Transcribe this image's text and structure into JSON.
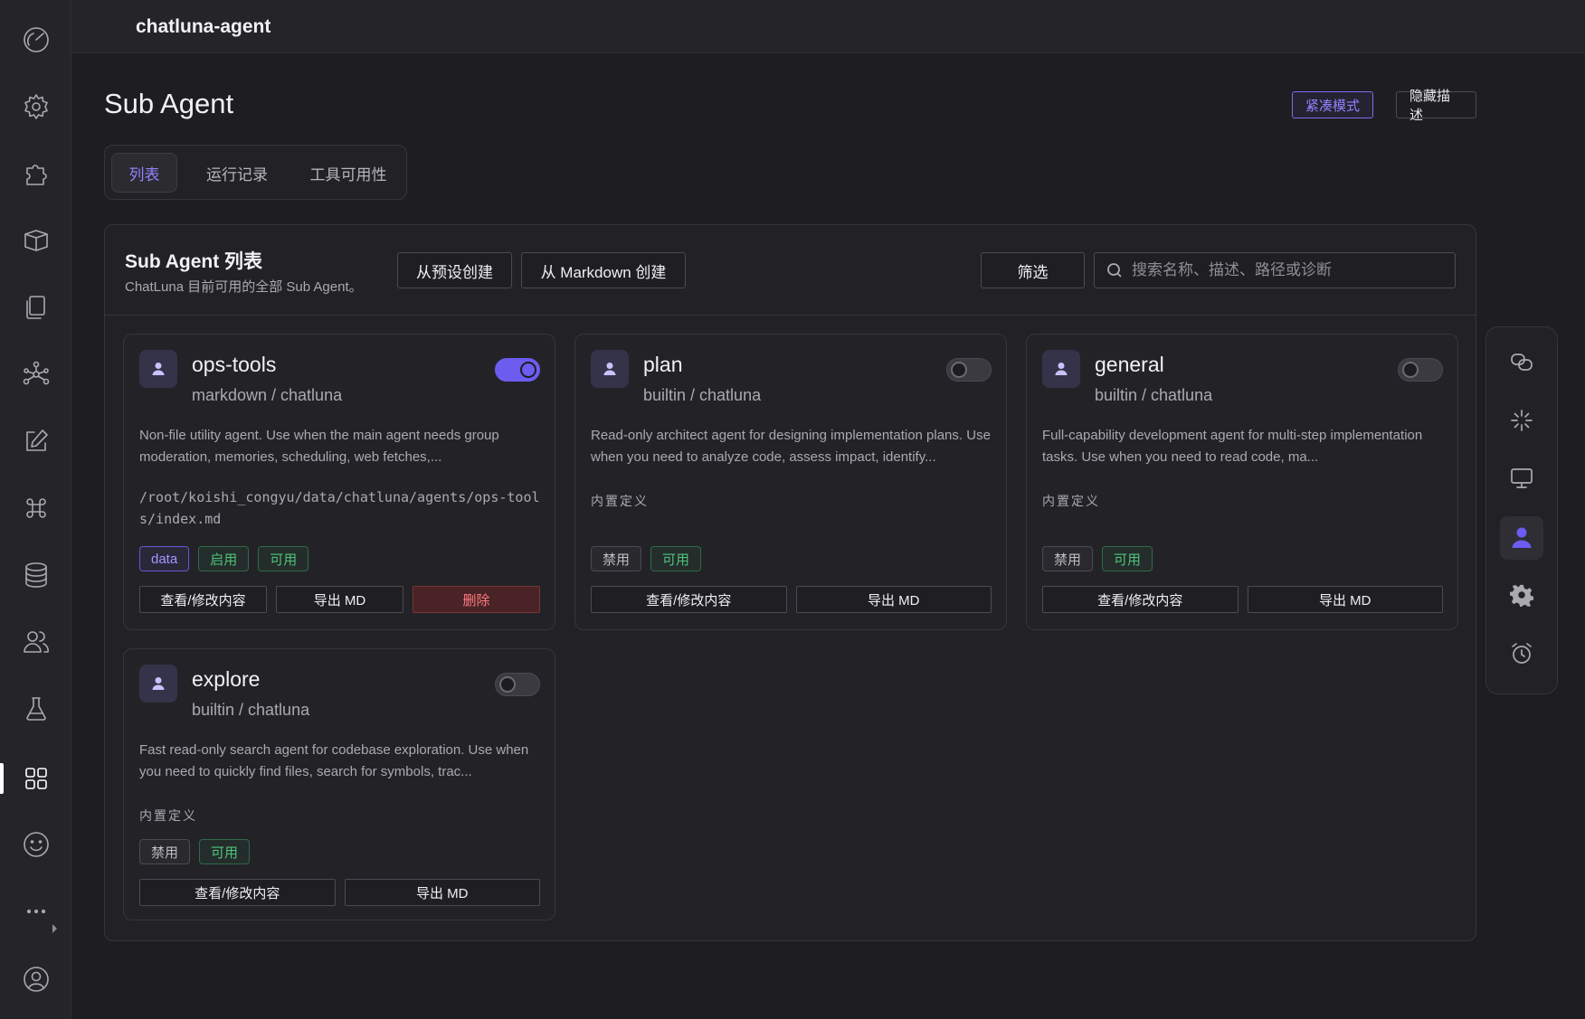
{
  "topbar": {
    "title": "chatluna-agent"
  },
  "page": {
    "title": "Sub Agent",
    "compact_mode_label": "紧凑模式",
    "hide_desc_label": "隐藏描述"
  },
  "tabs": [
    {
      "label": "列表",
      "active": true
    },
    {
      "label": "运行记录",
      "active": false
    },
    {
      "label": "工具可用性",
      "active": false
    }
  ],
  "panel": {
    "title": "Sub Agent 列表",
    "subtitle": "ChatLuna 目前可用的全部 Sub Agent。",
    "create_preset_label": "从预设创建",
    "create_markdown_label": "从 Markdown 创建",
    "filter_label": "筛选",
    "search_placeholder": "搜索名称、描述、路径或诊断"
  },
  "agents": [
    {
      "name": "ops-tools",
      "source": "markdown / chatluna",
      "enabled": true,
      "description": "Non-file utility agent. Use when the main agent needs group moderation, memories, scheduling, web fetches,...",
      "path": "/root/koishi_congyu/data/chatluna/agents/ops-tools/index.md",
      "tags": [
        "data",
        "启用",
        "可用"
      ],
      "actions": [
        "查看/修改内容",
        "导出 MD",
        "删除"
      ]
    },
    {
      "name": "plan",
      "source": "builtin / chatluna",
      "enabled": false,
      "description": "Read-only architect agent for designing implementation plans. Use when you need to analyze code, assess impact, identify...",
      "builtin_label": "内置定义",
      "tags": [
        "禁用",
        "可用"
      ],
      "actions": [
        "查看/修改内容",
        "导出 MD"
      ]
    },
    {
      "name": "general",
      "source": "builtin / chatluna",
      "enabled": false,
      "description": "Full-capability development agent for multi-step implementation tasks. Use when you need to read code, ma...",
      "builtin_label": "内置定义",
      "tags": [
        "禁用",
        "可用"
      ],
      "actions": [
        "查看/修改内容",
        "导出 MD"
      ]
    },
    {
      "name": "explore",
      "source": "builtin / chatluna",
      "enabled": false,
      "description": "Fast read-only search agent for codebase exploration. Use when you need to quickly find files, search for symbols, trac...",
      "builtin_label": "内置定义",
      "tags": [
        "禁用",
        "可用"
      ],
      "actions": [
        "查看/修改内容",
        "导出 MD"
      ]
    }
  ],
  "sidebar_icons": [
    "dashboard-icon",
    "settings-icon",
    "plugins-icon",
    "market-icon",
    "files-icon",
    "graph-icon",
    "edit-icon",
    "command-icon",
    "database-icon",
    "users-icon",
    "lab-icon",
    "apps-icon",
    "emoji-icon",
    "more-icon",
    "account-icon"
  ],
  "right_toolbar_icons": [
    "chat-icon",
    "loading-icon",
    "monitor-icon",
    "agent-icon",
    "gear-icon",
    "alarm-icon"
  ],
  "colors": {
    "accent": "#6c5cf0",
    "background": "#1e1e22",
    "success": "#4fc37a",
    "danger": "#ff7b80"
  }
}
